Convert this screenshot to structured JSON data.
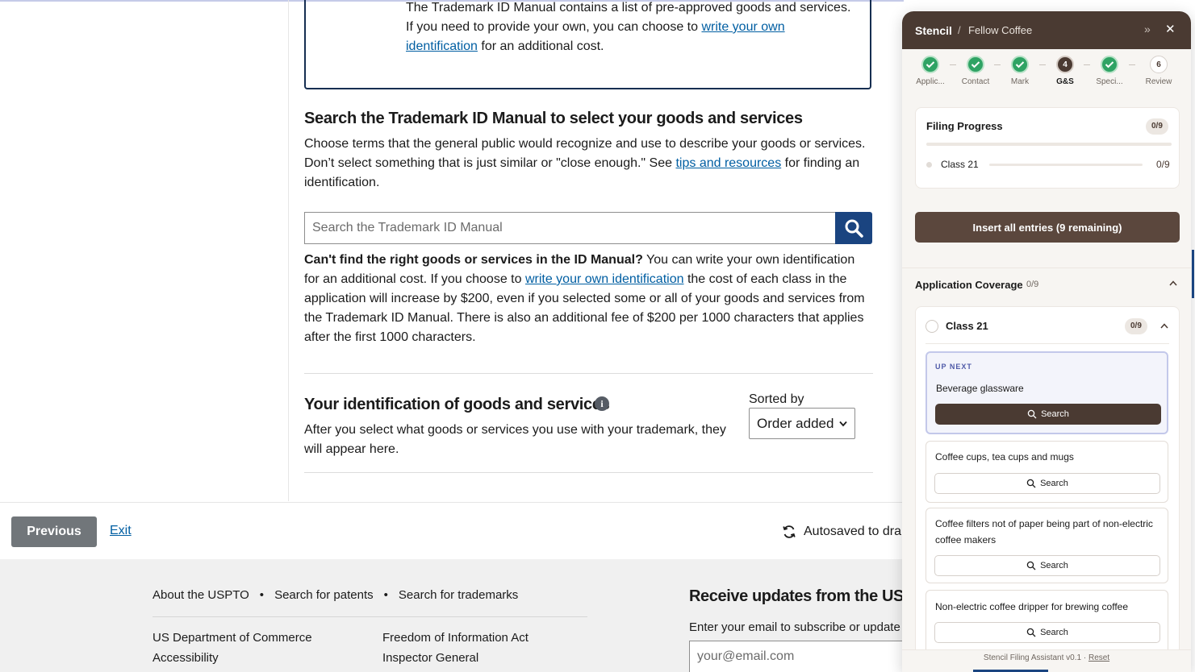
{
  "info_box": {
    "line1": "The Trademark ID Manual contains a list of pre-approved goods and services. If you need to provide your own, you can choose to ",
    "link": "write your own identification",
    "line2": " for an additional cost."
  },
  "search_section": {
    "heading": "Search the Trademark ID Manual to select your goods and services",
    "para_before": "Choose terms that the general public would recognize and use to describe your goods or services. Don’t select something that is just similar or \"close enough.\" See ",
    "para_link": "tips and resources",
    "para_after": " for finding an identification.",
    "input_placeholder": "Search the Trademark ID Manual",
    "cant_find_bold": "Can't find the right goods or services in the ID Manual?",
    "cant_find_before": " You can write your own identification for an additional cost. If you choose to ",
    "cant_find_link": "write your own identification",
    "cant_find_after": " the cost of each class in the application will increase by $200, even if you selected some or all of your goods and services from the Trademark ID Manual. There is also an additional fee of $200 per 1000 characters that applies after the first 1000 characters."
  },
  "your_id_section": {
    "heading": "Your identification of goods and services",
    "info_icon": "i",
    "description": "After you select what goods or services you use with your trademark, they will appear here.",
    "sorted_label": "Sorted by",
    "sort_value": "Order added"
  },
  "nav": {
    "previous": "Previous",
    "exit": "Exit",
    "autosave": "Autosaved to dra"
  },
  "footer": {
    "links": [
      "About the USPTO",
      "Search for patents",
      "Search for trademarks"
    ],
    "col1": [
      "US Department of Commerce",
      "Accessibility"
    ],
    "col2": [
      "Freedom of Information Act",
      "Inspector General"
    ],
    "updates_heading": "Receive updates from the USP",
    "updates_sub": "Enter your email to subscribe or update y",
    "email_placeholder": "your@email.com"
  },
  "panel": {
    "brand": "Stencil",
    "separator": "/",
    "company": "Fellow Coffee",
    "steps": [
      {
        "label": "Applic...",
        "state": "done",
        "num": ""
      },
      {
        "label": "Contact",
        "state": "done",
        "num": ""
      },
      {
        "label": "Mark",
        "state": "done",
        "num": ""
      },
      {
        "label": "G&S",
        "state": "current",
        "num": "4"
      },
      {
        "label": "Speci...",
        "state": "done",
        "num": ""
      },
      {
        "label": "Review",
        "state": "todo",
        "num": "6"
      }
    ],
    "filing_progress": {
      "title": "Filing Progress",
      "badge": "0/9",
      "class_label": "Class 21",
      "class_count": "0/9"
    },
    "insert_button": "Insert all entries (9 remaining)",
    "coverage": {
      "title": "Application Coverage",
      "count": "0/9",
      "class_label": "Class 21",
      "class_badge": "0/9"
    },
    "up_next_label": "UP NEXT",
    "items": [
      {
        "title": "Beverage glassware",
        "button": "Search"
      },
      {
        "title": "Coffee cups, tea cups and mugs",
        "button": "Search"
      },
      {
        "title": "Coffee filters not of paper being part of non-electric coffee makers",
        "button": "Search"
      },
      {
        "title": "Non-electric coffee dripper for brewing coffee",
        "button": "Search"
      }
    ],
    "footer_text": "Stencil Filing Assistant v0.1 · ",
    "footer_link": "Reset"
  },
  "colors": {
    "uswds_blue": "#005ea2",
    "navy": "#1a4480",
    "stencil_brown": "#4a3a32",
    "success_green": "#2fa364"
  }
}
